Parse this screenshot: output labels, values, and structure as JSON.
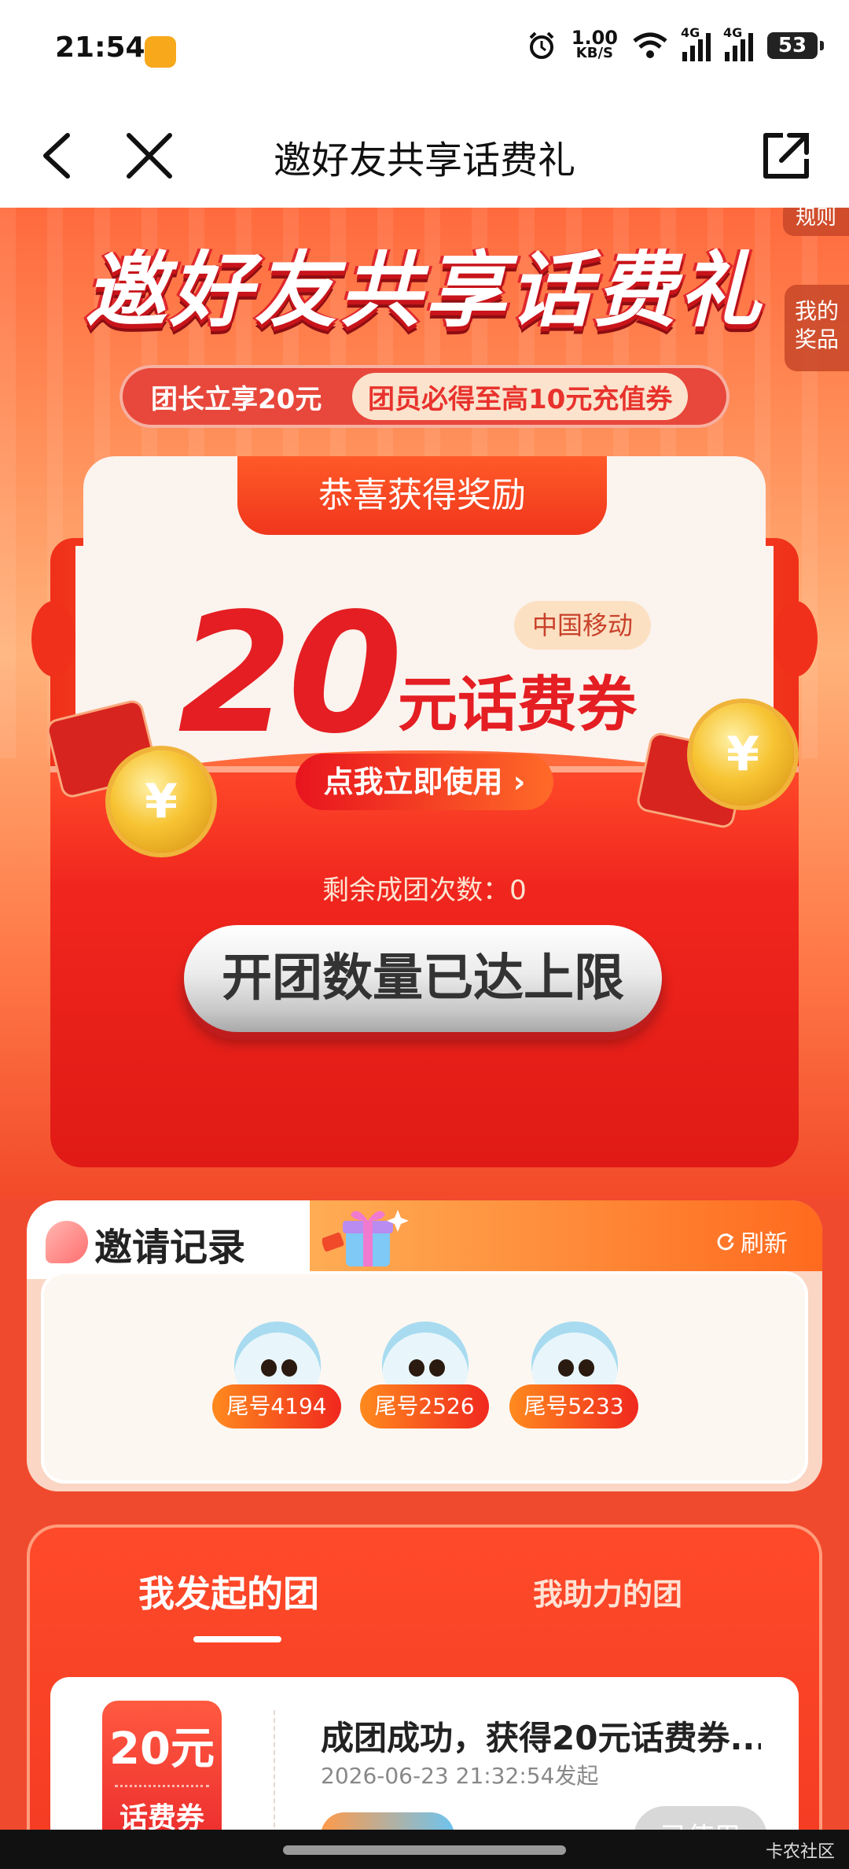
{
  "status_bar": {
    "time": "21:54",
    "net_speed_value": "1.00",
    "net_speed_unit": "KB/S",
    "signal1_label": "4G",
    "signal2_label": "4G",
    "battery": "53"
  },
  "nav": {
    "title": "邀好友共享话费礼",
    "back_icon": "chevron-left-icon",
    "close_icon": "close-icon",
    "share_icon": "share-icon"
  },
  "hero": {
    "title": "邀好友共享话费礼",
    "rules_tab": "规则",
    "prize_tab_line1": "我的",
    "prize_tab_line2": "奖品",
    "leader_text": "团长立享20元",
    "member_text": "团员必得至高10元充值券"
  },
  "reward": {
    "ribbon": "恭喜获得奖励",
    "amount": "20",
    "unit": "元话费券",
    "carrier": "中国移动",
    "use_button": "点我立即使用 ›",
    "remaining_label": "剩余成团次数：",
    "remaining_count": "0",
    "limit_button": "开团数量已达上限"
  },
  "invite": {
    "title": "邀请记录",
    "refresh": "刷新",
    "members": [
      {
        "label": "尾号4194"
      },
      {
        "label": "尾号2526"
      },
      {
        "label": "尾号5233"
      }
    ]
  },
  "groups": {
    "tab_started": "我发起的团",
    "tab_helped": "我助力的团",
    "item": {
      "coupon_amount": "20元",
      "coupon_kind": "话费券",
      "title": "成团成功，获得20元话费券...",
      "time": "2026-06-23 21:32:54发起",
      "status": "已使用"
    }
  },
  "watermark": "卡农社区",
  "colors": {
    "accent_red": "#e41e22",
    "orange": "#ff6a1e",
    "cream": "#fbf3ee"
  }
}
